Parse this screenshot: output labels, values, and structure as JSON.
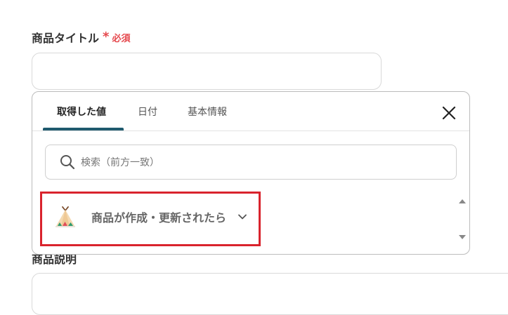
{
  "form": {
    "title_label": "商品タイトル",
    "required_mark": "*",
    "required_text": "必須",
    "title_value": "",
    "description_label": "商品説明",
    "description_value": ""
  },
  "popup": {
    "tabs": [
      {
        "label": "取得した値",
        "active": true
      },
      {
        "label": "日付",
        "active": false
      },
      {
        "label": "基本情報",
        "active": false
      }
    ],
    "close_icon": "close-icon",
    "search": {
      "placeholder": "検索（前方一致）",
      "value": "",
      "icon": "search-icon"
    },
    "items": [
      {
        "label": "商品が作成・更新されたら",
        "icon": "teepee-app-icon",
        "expand_icon": "chevron-down-icon"
      }
    ]
  },
  "colors": {
    "required": "#e5484d",
    "tab_underline": "#1f5a6e",
    "highlight": "#d9232d"
  }
}
